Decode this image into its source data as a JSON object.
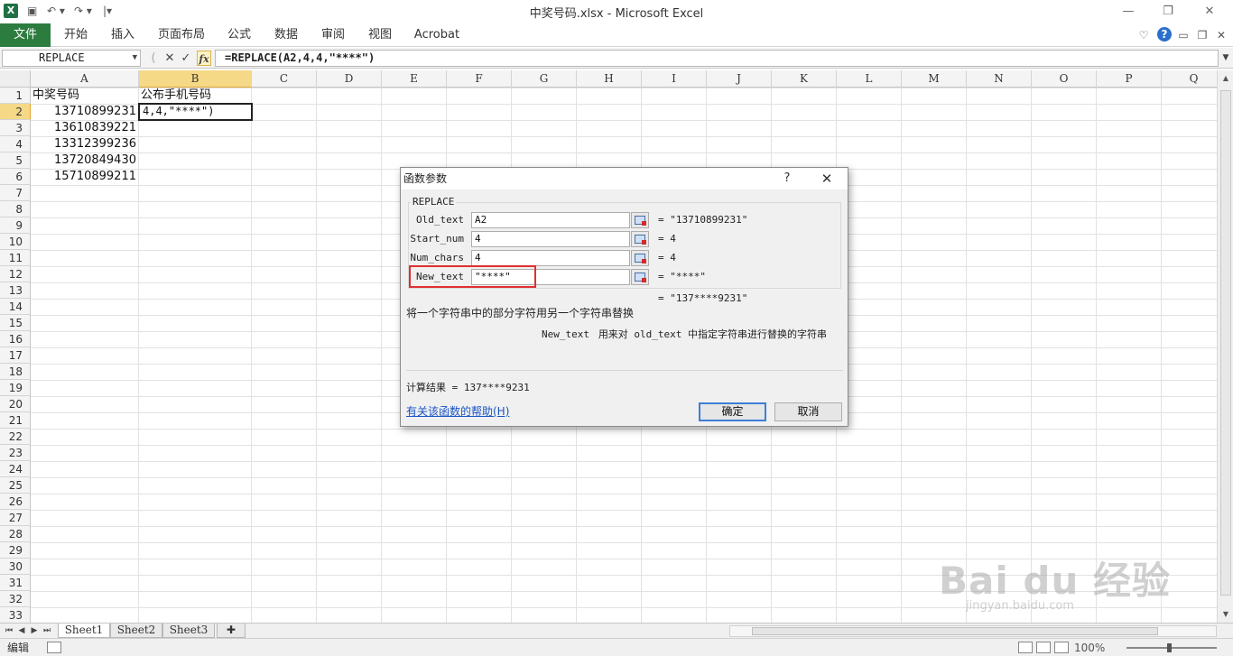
{
  "window": {
    "title": "中奖号码.xlsx  -  Microsoft Excel",
    "app_icon": "excel-icon",
    "qat": [
      "save-icon",
      "undo-icon",
      "redo-icon",
      "customize-qat-icon"
    ]
  },
  "ribbon": {
    "tabs": [
      "文件",
      "开始",
      "插入",
      "页面布局",
      "公式",
      "数据",
      "审阅",
      "视图",
      "Acrobat"
    ],
    "active_tab": "文件",
    "help_icon": "?"
  },
  "formula_bar": {
    "name_box": "REPLACE",
    "formula": "=REPLACE(A2,4,4,\"****\")",
    "cancel_glyph": "✕",
    "enter_glyph": "✓",
    "fx_glyph": "fx"
  },
  "grid": {
    "columns": [
      "A",
      "B",
      "C",
      "D",
      "E",
      "F",
      "G",
      "H",
      "I",
      "J",
      "K",
      "L",
      "M",
      "N",
      "O",
      "P",
      "Q"
    ],
    "selected_column": "B",
    "rows": [
      "1",
      "2",
      "3",
      "4",
      "5",
      "6",
      "7",
      "8",
      "9",
      "10",
      "11",
      "12",
      "13",
      "14",
      "15",
      "16",
      "17",
      "18",
      "19",
      "20",
      "21",
      "22",
      "23",
      "24",
      "25",
      "26",
      "27",
      "28",
      "29",
      "30",
      "31",
      "32",
      "33"
    ],
    "selected_row": "2",
    "cells": {
      "A1": "中奖号码",
      "B1": "公布手机号码",
      "A2": "13710899231",
      "A3": "13610839221",
      "A4": "13312399236",
      "A5": "13720849430",
      "A6": "15710899211",
      "B2": "4,4,\"****\")"
    }
  },
  "sheet_tabs": [
    "Sheet1",
    "Sheet2",
    "Sheet3"
  ],
  "active_sheet": "Sheet1",
  "status_bar": {
    "mode": "编辑",
    "zoom": "100%"
  },
  "dialog": {
    "title": "函数参数",
    "help_glyph": "?",
    "close_glyph": "✕",
    "function_name": "REPLACE",
    "args": [
      {
        "label": "Old_text",
        "value": "A2",
        "result": "= \"13710899231\""
      },
      {
        "label": "Start_num",
        "value": "4",
        "result": "= 4"
      },
      {
        "label": "Num_chars",
        "value": "4",
        "result": "= 4"
      },
      {
        "label": "New_text",
        "value": "\"****\"",
        "result": "= \"****\""
      }
    ],
    "overall_result": "= \"137****9231\"",
    "description": "将一个字符串中的部分字符用另一个字符串替换",
    "arg_help_name": "New_text",
    "arg_help_text": "用来对 old_text 中指定字符串进行替换的字符串",
    "calc_result": "计算结果 =  137****9231",
    "help_link": "有关该函数的帮助(H)",
    "ok_label": "确定",
    "cancel_label": "取消"
  },
  "watermark": {
    "main": "Bai du 经验",
    "sub": "jingyan.baidu.com"
  }
}
